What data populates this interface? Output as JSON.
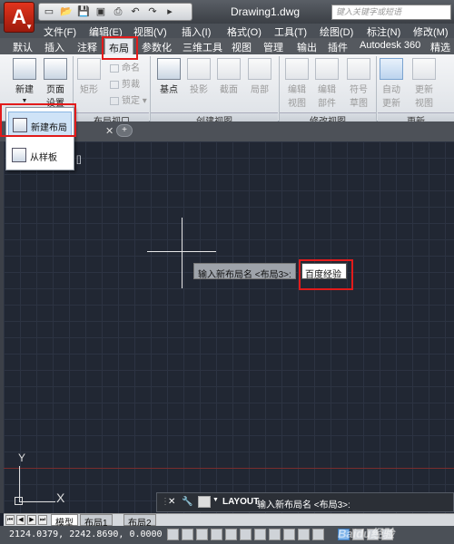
{
  "app": {
    "logo": "A",
    "document_title": "Drawing1.dwg",
    "search_placeholder": "键入关键字或短语"
  },
  "quick_access": [
    "new-icon",
    "open-icon",
    "save-icon",
    "saveas-icon",
    "print-icon",
    "undo-icon",
    "redo-icon"
  ],
  "menubar": [
    "文件(F)",
    "编辑(E)",
    "视图(V)",
    "插入(I)",
    "格式(O)",
    "工具(T)",
    "绘图(D)",
    "标注(N)",
    "修改(M)"
  ],
  "ribbon_tabs": [
    "默认",
    "插入",
    "注释",
    "布局",
    "参数化",
    "三维工具",
    "视图",
    "管理",
    "输出",
    "插件",
    "Autodesk 360",
    "精选应用"
  ],
  "active_ribbon_tab": "布局",
  "ribbon": {
    "layout_group": {
      "new": "新建",
      "page_setup_1": "页面",
      "page_setup_2": "设置"
    },
    "viewport_group": {
      "label": "布局视口",
      "rect": "矩形",
      "name": "命名",
      "clip": "剪裁",
      "lock": "锁定"
    },
    "create_view_group": {
      "label": "创建视图",
      "base": "基点",
      "projected": "投影",
      "section": "截面",
      "detail": "局部"
    },
    "modify_view_group": {
      "label": "修改视图",
      "edit_view_1": "编辑",
      "edit_view_2": "视图",
      "edit_part_1": "编辑",
      "edit_part_2": "部件",
      "symbol_1": "符号",
      "symbol_2": "草图"
    },
    "update_group": {
      "label": "更新",
      "auto_1": "自动",
      "auto_2": "更新",
      "update_1": "更新",
      "update_2": "视图"
    }
  },
  "dropdown": {
    "new_layout": "新建布局",
    "from_template": "从样板"
  },
  "canvas_label": "[]",
  "dynamic_input": {
    "prompt": "输入新布局名 <布局3>:",
    "value": "百度经验"
  },
  "ucs": {
    "x": "X",
    "y": "Y"
  },
  "command_line": {
    "close": "✕",
    "keyword": "LAYOUT",
    "prompt": "输入新布局名 <布局3>:"
  },
  "layout_tabs": [
    "模型",
    "布局1",
    "布局2"
  ],
  "active_layout_tab": "模型",
  "status": {
    "coordinates": "2124.0379, 2242.8690, 0.0000"
  },
  "watermark": "Baidu经验"
}
